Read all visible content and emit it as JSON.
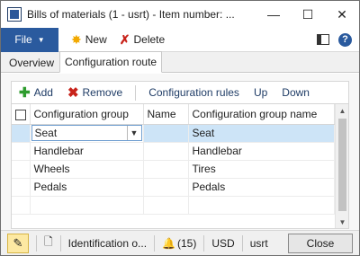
{
  "window": {
    "title": "Bills of materials (1 - usrt) - Item number: ...",
    "minimize_glyph": "—",
    "maximize_glyph": "☐",
    "close_glyph": "✕"
  },
  "ribbon": {
    "file_label": "File",
    "new_label": "New",
    "delete_label": "Delete",
    "help_glyph": "?"
  },
  "tabs": [
    {
      "label": "Overview",
      "active": false
    },
    {
      "label": "Configuration route",
      "active": true
    }
  ],
  "toolbar": {
    "add_label": "Add",
    "remove_label": "Remove",
    "configuration_rules_label": "Configuration rules",
    "up_label": "Up",
    "down_label": "Down"
  },
  "grid": {
    "columns": [
      "Configuration group",
      "Name",
      "Configuration group name"
    ],
    "rows": [
      {
        "group": "Seat",
        "name": "",
        "group_name": "Seat",
        "selected": true
      },
      {
        "group": "Handlebar",
        "name": "",
        "group_name": "Handlebar",
        "selected": false
      },
      {
        "group": "Wheels",
        "name": "",
        "group_name": "Tires",
        "selected": false
      },
      {
        "group": "Pedals",
        "name": "",
        "group_name": "Pedals",
        "selected": false
      }
    ]
  },
  "statusbar": {
    "identification": "Identification o...",
    "notifications": "(15)",
    "currency": "USD",
    "company": "usrt",
    "close_label": "Close"
  },
  "colors": {
    "accent": "#2a5a9e",
    "selected_row": "#cde4f7"
  }
}
